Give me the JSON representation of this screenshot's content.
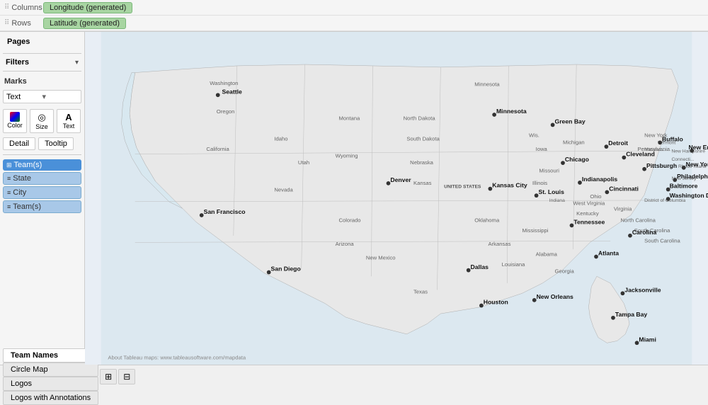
{
  "shelf": {
    "columns_label": "Columns",
    "rows_label": "Rows",
    "columns_pill": "Longitude (generated)",
    "rows_pill": "Latitude (generated)"
  },
  "left_panel": {
    "pages_title": "Pages",
    "filters_title": "Filters",
    "marks_title": "Marks",
    "marks_type": "Text",
    "marks_type_arrow": "▾",
    "color_label": "Color",
    "size_label": "Size",
    "text_label": "Text",
    "detail_label": "Detail",
    "tooltip_label": "Tooltip",
    "fields": [
      {
        "id": "teams",
        "label": "Team(s)",
        "type": "blue",
        "icon": "⊞"
      },
      {
        "id": "state",
        "label": "State",
        "type": "light-blue",
        "icon": "≡"
      },
      {
        "id": "city",
        "label": "City",
        "type": "light-blue",
        "icon": "≡"
      },
      {
        "id": "teams2",
        "label": "Team(s)",
        "type": "light-blue",
        "icon": "≡"
      }
    ]
  },
  "cities": [
    {
      "id": "seattle",
      "label": "Seattle",
      "left": "183",
      "top": "89"
    },
    {
      "id": "minnesota",
      "label": "Minnesota",
      "left": "580",
      "top": "120"
    },
    {
      "id": "green-bay",
      "label": "Green Bay",
      "left": "667",
      "top": "133"
    },
    {
      "id": "detroit",
      "label": "Detroit",
      "left": "745",
      "top": "165"
    },
    {
      "id": "buffalo",
      "label": "Buffalo",
      "left": "825",
      "top": "158"
    },
    {
      "id": "new-england",
      "label": "New England",
      "left": "895",
      "top": "170"
    },
    {
      "id": "chicago",
      "label": "Chicago",
      "left": "681",
      "top": "189"
    },
    {
      "id": "cleveland",
      "label": "Cleveland",
      "left": "771",
      "top": "182"
    },
    {
      "id": "new-york",
      "label": "New York",
      "left": "878",
      "top": "196"
    },
    {
      "id": "pittsburgh",
      "label": "Pittsburgh",
      "left": "800",
      "top": "198"
    },
    {
      "id": "indianapolis",
      "label": "Indianapolis",
      "left": "706",
      "top": "218"
    },
    {
      "id": "cincinnati",
      "label": "Cincinnati",
      "left": "745",
      "top": "232"
    },
    {
      "id": "philadelphia",
      "label": "Philadelphia",
      "left": "852",
      "top": "213"
    },
    {
      "id": "kansas-city",
      "label": "Kansas City",
      "left": "574",
      "top": "227"
    },
    {
      "id": "st-louis",
      "label": "St. Louis",
      "left": "641",
      "top": "237"
    },
    {
      "id": "baltimore",
      "label": "Baltimore",
      "left": "839",
      "top": "228"
    },
    {
      "id": "washington-dc",
      "label": "Washington D.C.",
      "left": "839",
      "top": "242"
    },
    {
      "id": "denver",
      "label": "Denver",
      "left": "424",
      "top": "219"
    },
    {
      "id": "san-francisco",
      "label": "San Francisco",
      "left": "160",
      "top": "266"
    },
    {
      "id": "tennessee",
      "label": "Tennessee",
      "left": "693",
      "top": "281"
    },
    {
      "id": "carolina",
      "label": "Carolina",
      "left": "779",
      "top": "295"
    },
    {
      "id": "atlanta",
      "label": "Atlanta",
      "left": "730",
      "top": "327"
    },
    {
      "id": "dallas",
      "label": "Dallas",
      "left": "541",
      "top": "347"
    },
    {
      "id": "san-diego",
      "label": "San Diego",
      "left": "247",
      "top": "350"
    },
    {
      "id": "new-orleans",
      "label": "New Orleans",
      "left": "636",
      "top": "391"
    },
    {
      "id": "houston",
      "label": "Houston",
      "left": "559",
      "top": "399"
    },
    {
      "id": "jacksonville",
      "label": "Jacksonville",
      "left": "769",
      "top": "381"
    },
    {
      "id": "tampa-bay",
      "label": "Tampa Bay",
      "left": "754",
      "top": "417"
    },
    {
      "id": "miami",
      "label": "Miami",
      "left": "789",
      "top": "455"
    }
  ],
  "attribution": "About Tableau maps: www.tableausoftware.com/mapdata",
  "bottom_tabs": [
    {
      "id": "team-names",
      "label": "Team Names",
      "active": true
    },
    {
      "id": "circle-map",
      "label": "Circle Map",
      "active": false
    },
    {
      "id": "logos",
      "label": "Logos",
      "active": false
    },
    {
      "id": "logos-annotations",
      "label": "Logos with Annotations",
      "active": false
    }
  ],
  "bottom_icons": [
    "⊞",
    "⊟"
  ]
}
